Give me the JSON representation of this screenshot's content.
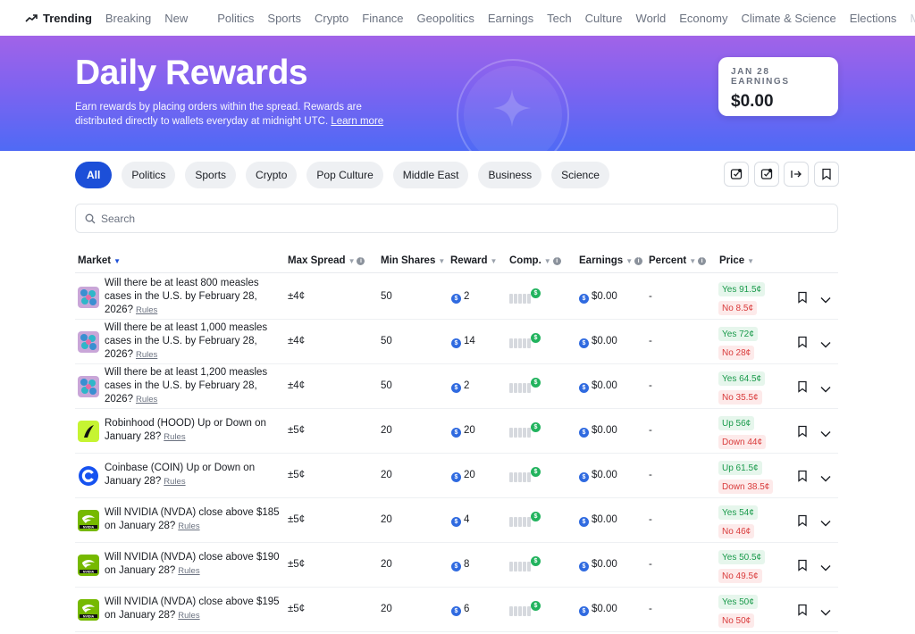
{
  "nav": {
    "trending": "Trending",
    "items": [
      "Breaking",
      "New"
    ],
    "categories": [
      "Politics",
      "Sports",
      "Crypto",
      "Finance",
      "Geopolitics",
      "Earnings",
      "Tech",
      "Culture",
      "World",
      "Economy",
      "Climate & Science",
      "Elections"
    ],
    "overflow": "Mo"
  },
  "hero": {
    "title": "Daily Rewards",
    "description": "Earn rewards by placing orders within the spread. Rewards are distributed directly to wallets everyday at midnight UTC.",
    "learn_more": "Learn more",
    "earnings_label": "JAN 28 EARNINGS",
    "earnings_value": "$0.00"
  },
  "filters": [
    "All",
    "Politics",
    "Sports",
    "Crypto",
    "Pop Culture",
    "Middle East",
    "Business",
    "Science"
  ],
  "search": {
    "placeholder": "Search"
  },
  "table": {
    "headers": {
      "market": "Market",
      "max_spread": "Max Spread",
      "min_shares": "Min Shares",
      "reward": "Reward",
      "comp": "Comp.",
      "earnings": "Earnings",
      "percent": "Percent",
      "price": "Price"
    },
    "rules_label": "Rules",
    "rows": [
      {
        "title": "Will there be at least 800 measles cases in the U.S. by February 28, 2026?",
        "max_spread": "±4¢",
        "min_shares": "50",
        "reward": "2",
        "earnings": "$0.00",
        "percent": "-",
        "price_yes": "Yes 91.5¢",
        "price_no": "No 8.5¢",
        "icon": "measles-icon"
      },
      {
        "title": "Will there be at least 1,000 measles cases in the U.S. by February 28, 2026?",
        "max_spread": "±4¢",
        "min_shares": "50",
        "reward": "14",
        "earnings": "$0.00",
        "percent": "-",
        "price_yes": "Yes 72¢",
        "price_no": "No 28¢",
        "icon": "measles-icon"
      },
      {
        "title": "Will there be at least 1,200 measles cases in the U.S. by February 28, 2026?",
        "max_spread": "±4¢",
        "min_shares": "50",
        "reward": "2",
        "earnings": "$0.00",
        "percent": "-",
        "price_yes": "Yes 64.5¢",
        "price_no": "No 35.5¢",
        "icon": "measles-icon"
      },
      {
        "title": "Robinhood (HOOD) Up or Down on January 28?",
        "max_spread": "±5¢",
        "min_shares": "20",
        "reward": "20",
        "earnings": "$0.00",
        "percent": "-",
        "price_yes": "Up 56¢",
        "price_no": "Down 44¢",
        "icon": "robinhood-icon"
      },
      {
        "title": "Coinbase (COIN) Up or Down on January 28?",
        "max_spread": "±5¢",
        "min_shares": "20",
        "reward": "20",
        "earnings": "$0.00",
        "percent": "-",
        "price_yes": "Up 61.5¢",
        "price_no": "Down 38.5¢",
        "icon": "coinbase-icon"
      },
      {
        "title": "Will NVIDIA (NVDA) close above $185 on January 28?",
        "max_spread": "±5¢",
        "min_shares": "20",
        "reward": "4",
        "earnings": "$0.00",
        "percent": "-",
        "price_yes": "Yes 54¢",
        "price_no": "No 46¢",
        "icon": "nvidia-icon"
      },
      {
        "title": "Will NVIDIA (NVDA) close above $190 on January 28?",
        "max_spread": "±5¢",
        "min_shares": "20",
        "reward": "8",
        "earnings": "$0.00",
        "percent": "-",
        "price_yes": "Yes 50.5¢",
        "price_no": "No 49.5¢",
        "icon": "nvidia-icon"
      },
      {
        "title": "Will NVIDIA (NVDA) close above $195 on January 28?",
        "max_spread": "±5¢",
        "min_shares": "20",
        "reward": "6",
        "earnings": "$0.00",
        "percent": "-",
        "price_yes": "Yes 50¢",
        "price_no": "No 50¢",
        "icon": "nvidia-icon"
      }
    ]
  },
  "colors": {
    "accent": "#1c4fd8",
    "yes": "#1a9a4b",
    "no": "#d93b3b",
    "hero_top": "#a163e8",
    "hero_bottom": "#4f6af5"
  }
}
